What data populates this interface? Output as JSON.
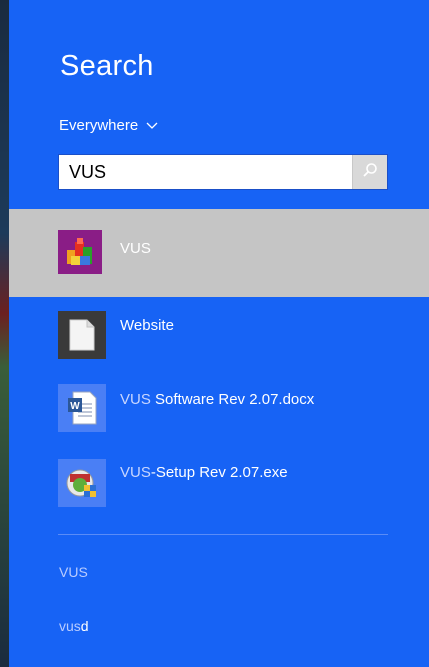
{
  "panel": {
    "title": "Search",
    "scope_label": "Everywhere"
  },
  "search": {
    "value": "VUS",
    "placeholder": ""
  },
  "results": [
    {
      "highlight": "VUS",
      "rest": "",
      "icon": "colorful-cubes-app-icon",
      "selected": true
    },
    {
      "highlight": "",
      "rest": "Website",
      "icon": "blank-document-icon",
      "selected": false
    },
    {
      "highlight": "VUS",
      "rest": " Software Rev 2.07.docx",
      "icon": "word-document-icon",
      "selected": false
    },
    {
      "highlight": "VUS",
      "rest": "-Setup Rev 2.07.exe",
      "icon": "installer-setup-icon",
      "selected": false
    }
  ],
  "suggestions": [
    {
      "highlight": "VUS",
      "rest": ""
    },
    {
      "highlight": "vus",
      "rest": "d"
    }
  ],
  "colors": {
    "background": "#1763f5",
    "selected_row": "#c5c5c5",
    "highlight_text": "#c8d6ff"
  }
}
